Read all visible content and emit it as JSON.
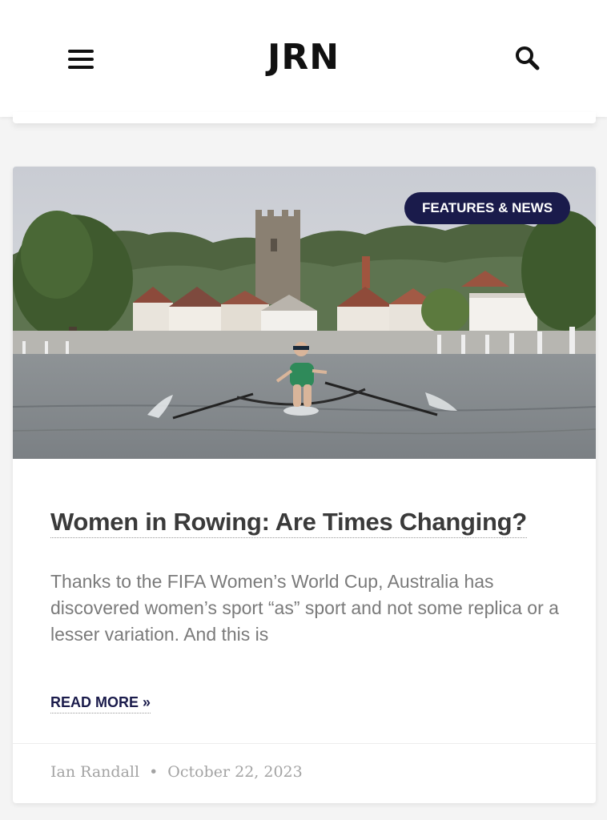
{
  "header": {
    "logo": "JRN",
    "menu_icon": "hamburger-menu-icon",
    "search_icon": "search-icon"
  },
  "article": {
    "category_badge": "FEATURES & NEWS",
    "title": "Women in Rowing: Are Times Changing?",
    "excerpt": "Thanks to the FIFA Women’s World Cup, Australia has discovered women’s sport “as” sport and not some replica or a lesser variation. And this is",
    "read_more_label": "READ MORE »",
    "author": "Ian Randall",
    "separator": "•",
    "date": "October 22, 2023"
  },
  "colors": {
    "brand_navy": "#1a1b4b",
    "title_text": "#3a3a3a",
    "body_text": "#7a7a7a",
    "meta_text": "#a3a3a3"
  }
}
